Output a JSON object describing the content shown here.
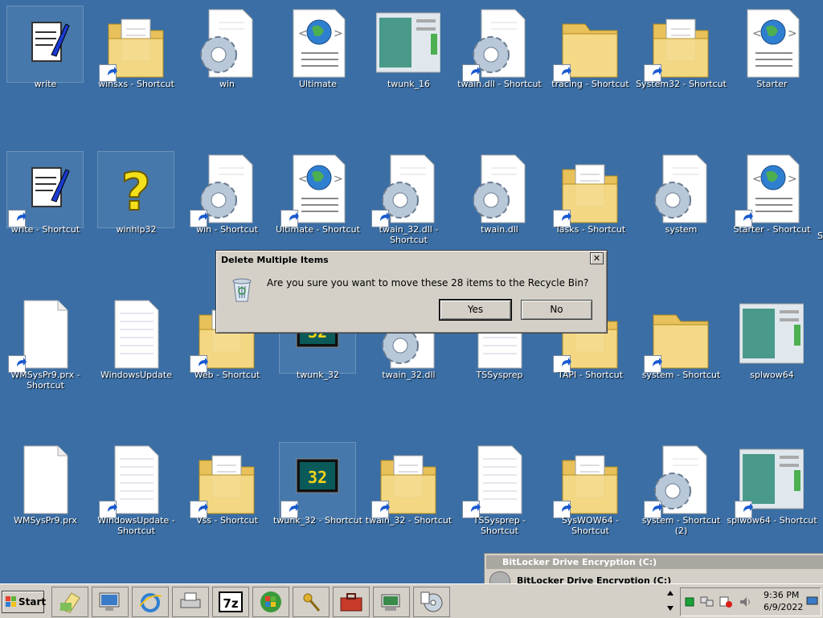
{
  "desktop": {
    "icons": [
      {
        "label": "write",
        "type": "notepad",
        "shortcut": false,
        "selected": true
      },
      {
        "label": "winsxs - Shortcut",
        "type": "folder-docs",
        "shortcut": true
      },
      {
        "label": "win",
        "type": "gear-doc",
        "shortcut": false
      },
      {
        "label": "Ultimate",
        "type": "globe-doc",
        "shortcut": false
      },
      {
        "label": "twunk_16",
        "type": "window",
        "shortcut": false
      },
      {
        "label": "twain.dll - Shortcut",
        "type": "gear-doc",
        "shortcut": true
      },
      {
        "label": "tracing - Shortcut",
        "type": "folder",
        "shortcut": true
      },
      {
        "label": "System32 - Shortcut",
        "type": "folder-docs",
        "shortcut": true
      },
      {
        "label": "Starter",
        "type": "globe-doc",
        "shortcut": false
      },
      {
        "label": "write - Shortcut",
        "type": "notepad",
        "shortcut": true,
        "selected": true
      },
      {
        "label": "winhlp32",
        "type": "help",
        "shortcut": false,
        "selected": true
      },
      {
        "label": "win - Shortcut",
        "type": "gear-doc",
        "shortcut": true
      },
      {
        "label": "Ultimate - Shortcut",
        "type": "globe-doc",
        "shortcut": true
      },
      {
        "label": "twain_32.dll - Shortcut",
        "type": "gear-doc",
        "shortcut": true
      },
      {
        "label": "twain.dll",
        "type": "gear-doc",
        "shortcut": false
      },
      {
        "label": "Tasks - Shortcut",
        "type": "folder-docs",
        "shortcut": true
      },
      {
        "label": "system",
        "type": "gear-doc",
        "shortcut": false
      },
      {
        "label": "Starter - Shortcut",
        "type": "globe-doc",
        "shortcut": true
      },
      {
        "label": "WMSysPr9.prx - Shortcut",
        "type": "blank",
        "shortcut": true
      },
      {
        "label": "WindowsUpdate",
        "type": "lined",
        "shortcut": false
      },
      {
        "label": "Web - Shortcut",
        "type": "folder-docs",
        "shortcut": true
      },
      {
        "label": "twunk_32",
        "type": "chip",
        "shortcut": false,
        "selected": true
      },
      {
        "label": "twain_32.dll",
        "type": "gear-doc",
        "shortcut": false
      },
      {
        "label": "TSSysprep",
        "type": "lined",
        "shortcut": false
      },
      {
        "label": "TAPI - Shortcut",
        "type": "folder-docs",
        "shortcut": true
      },
      {
        "label": "system - Shortcut",
        "type": "folder",
        "shortcut": true
      },
      {
        "label": "splwow64",
        "type": "window",
        "shortcut": false
      },
      {
        "label": "WMSysPr9.prx",
        "type": "blank",
        "shortcut": false
      },
      {
        "label": "WindowsUpdate - Shortcut",
        "type": "lined",
        "shortcut": true
      },
      {
        "label": "Vss - Shortcut",
        "type": "folder-docs",
        "shortcut": true
      },
      {
        "label": "twunk_32 - Shortcut",
        "type": "chip",
        "shortcut": true,
        "selected": true
      },
      {
        "label": "twain_32 - Shortcut",
        "type": "folder-docs",
        "shortcut": true
      },
      {
        "label": "TSSysprep - Shortcut",
        "type": "lined",
        "shortcut": true
      },
      {
        "label": "SysWOW64 - Shortcut",
        "type": "folder-docs",
        "shortcut": true
      },
      {
        "label": "system - Shortcut (2)",
        "type": "gear-doc",
        "shortcut": true
      },
      {
        "label": "splwow64 - Shortcut",
        "type": "window",
        "shortcut": true
      }
    ],
    "partial_label": "S"
  },
  "dialog": {
    "title": "Delete Multiple Items",
    "close_glyph": "✕",
    "message": "Are you sure you want to move these 28 items to the Recycle Bin?",
    "yes_label": "Yes",
    "no_label": "No"
  },
  "bitlocker": {
    "title": "BitLocker Drive Encryption (C:)",
    "subtitle": "BitLocker Drive Encryption (C:)"
  },
  "taskbar": {
    "start_label": "Start",
    "clock_time": "9:36 PM",
    "clock_date": "6/9/2022"
  },
  "colors": {
    "desktop": "#3a6ea5",
    "folder": "#f2d27a",
    "globe": "#2f7fd1"
  }
}
